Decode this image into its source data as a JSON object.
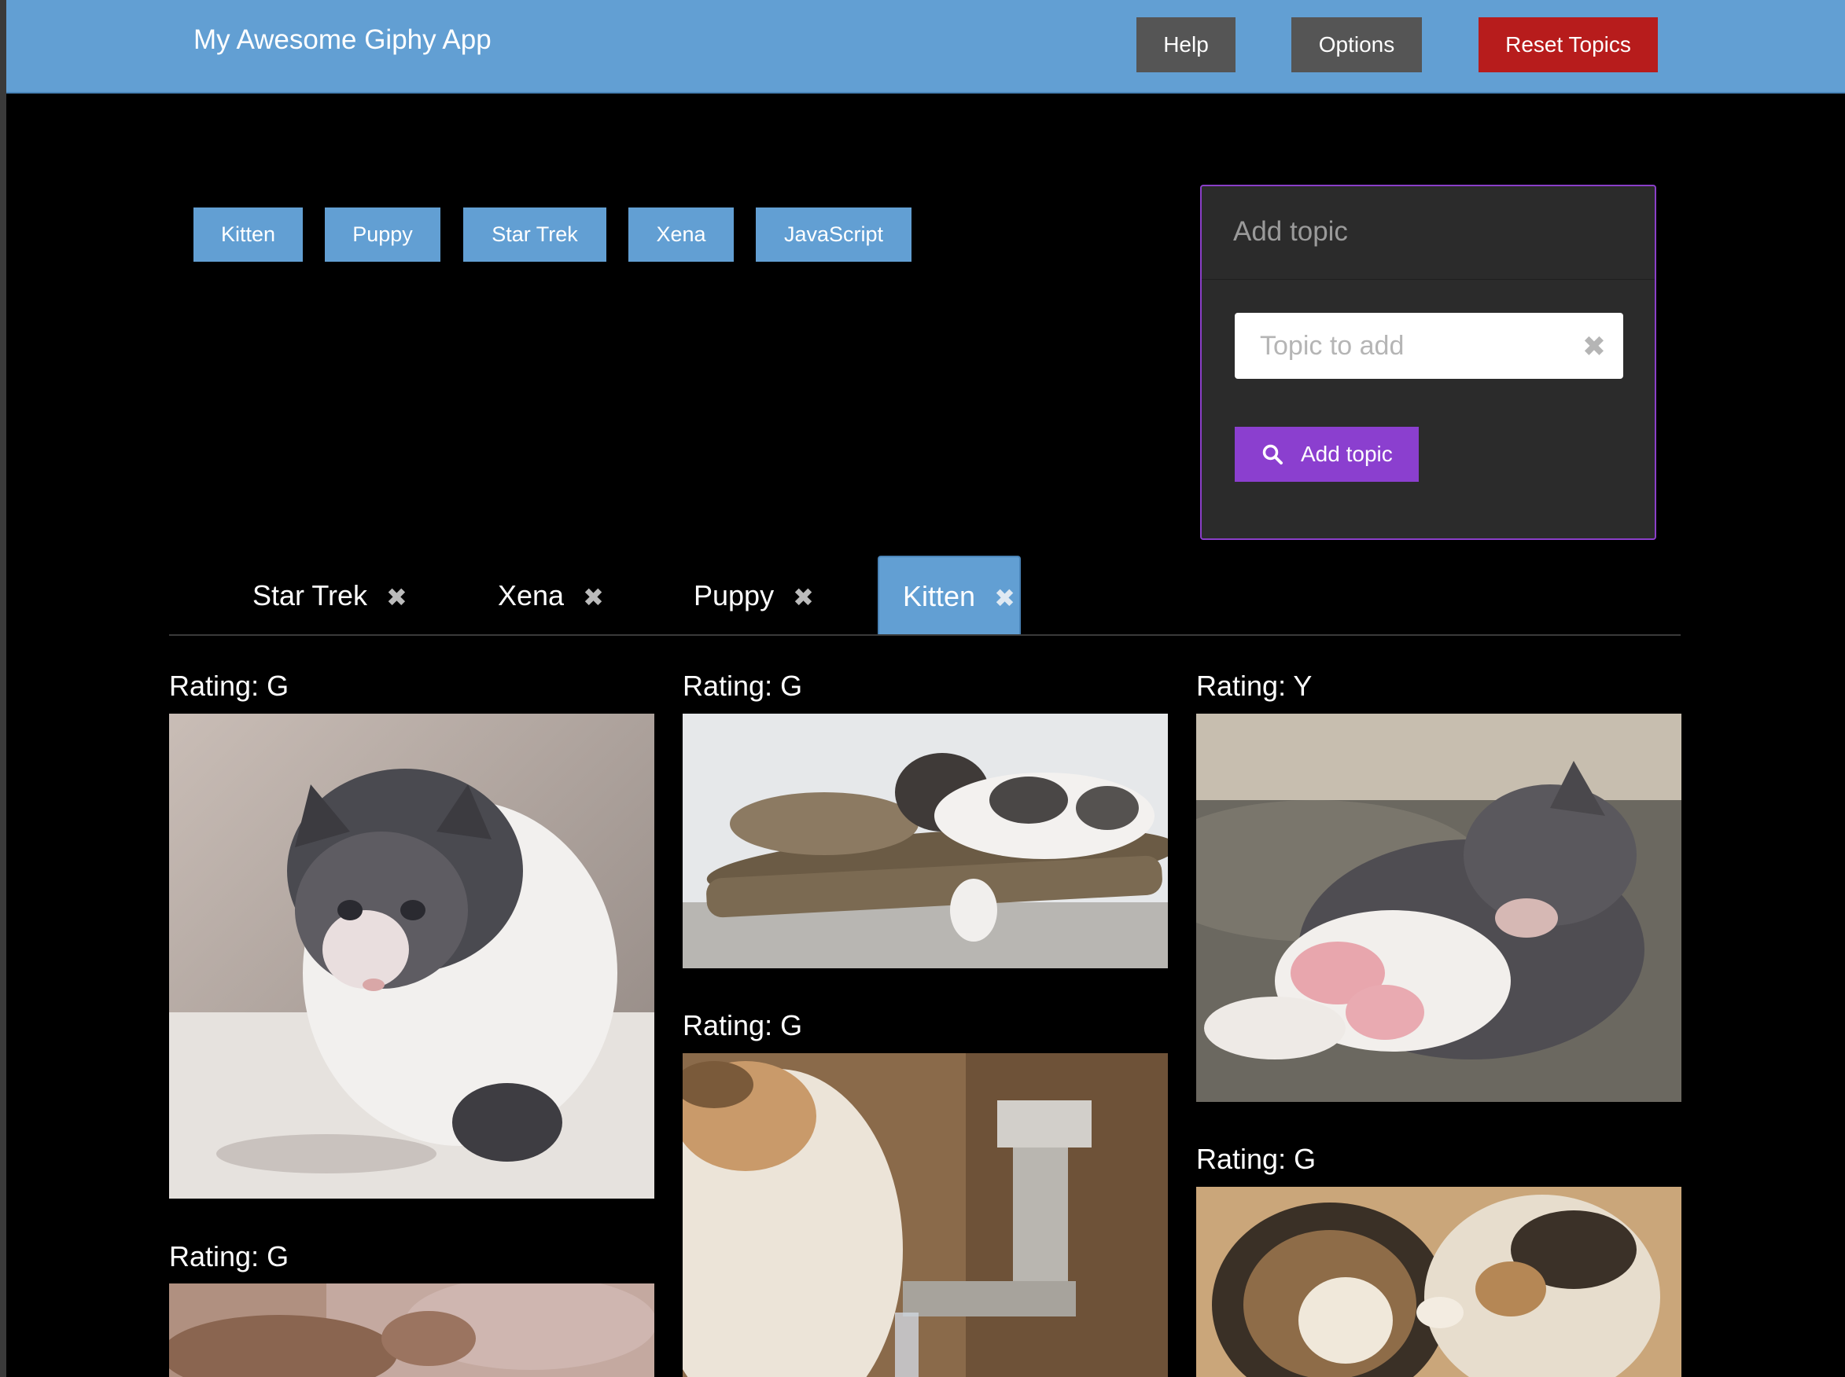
{
  "navbar": {
    "brand": "My Awesome Giphy App",
    "help_label": "Help",
    "options_label": "Options",
    "reset_label": "Reset Topics"
  },
  "topic_buttons": [
    "Kitten",
    "Puppy",
    "Star Trek",
    "Xena",
    "JavaScript"
  ],
  "add_panel": {
    "title": "Add topic",
    "input_placeholder": "Topic to add",
    "input_value": "",
    "clear_icon": "close-icon",
    "button_label": "Add topic",
    "button_icon": "search-icon"
  },
  "tabs": [
    {
      "label": "Star Trek",
      "active": false
    },
    {
      "label": "Xena",
      "active": false
    },
    {
      "label": "Puppy",
      "active": false
    },
    {
      "label": "Kitten",
      "active": true
    }
  ],
  "gifs": [
    {
      "rating": "Rating: G"
    },
    {
      "rating": "Rating: G"
    },
    {
      "rating": "Rating: Y"
    },
    {
      "rating": "Rating: G"
    },
    {
      "rating": "Rating: G"
    },
    {
      "rating": "Rating: G"
    }
  ],
  "colors": {
    "navbar": "#629fd3",
    "reset_button": "#b71c1c",
    "accent_purple": "#8b3fcf",
    "background": "#000000"
  }
}
